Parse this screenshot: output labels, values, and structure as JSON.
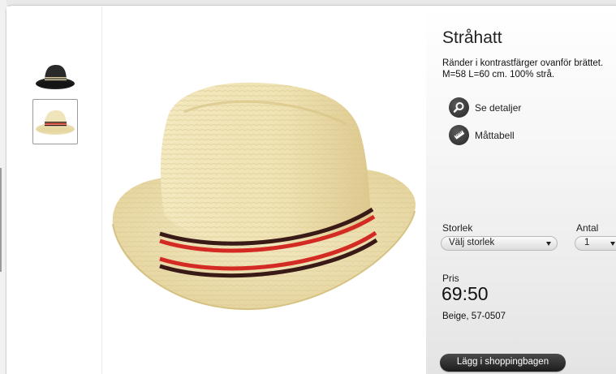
{
  "product": {
    "title": "Stråhatt",
    "description_line1": "Ränder i kontrastfärger ovanför brättet.",
    "description_line2": "M=58 L=60 cm. 100% strå.",
    "details_link": "Se detaljer",
    "size_chart_link": "Måttabell",
    "size_label": "Storlek",
    "size_select_value": "Välj storlek",
    "quantity_label": "Antal",
    "quantity_select_value": "1",
    "price_label": "Pris",
    "price": "69:50",
    "variant": "Beige, 57-0507",
    "add_to_bag": "Lägg i shoppingbagen"
  },
  "thumbnails": [
    {
      "icon": "black-hat-thumbnail",
      "selected": false
    },
    {
      "icon": "straw-hat-thumbnail",
      "selected": true
    }
  ],
  "icons": {
    "details": "magnifier-icon",
    "size_chart": "ruler-icon"
  },
  "colors": {
    "button": "#262626",
    "hat_straw": "#ecdfae",
    "hat_stripe_red": "#d42a24",
    "hat_stripe_dark": "#3a1a16"
  }
}
